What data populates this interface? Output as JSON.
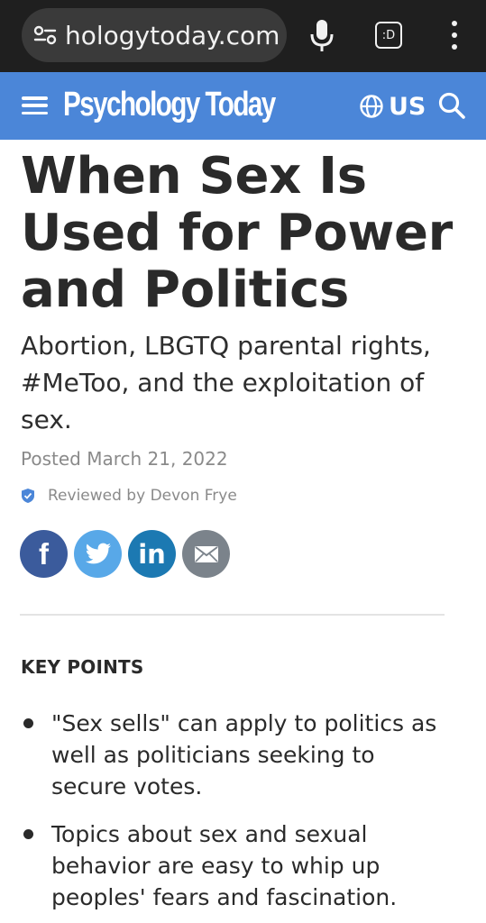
{
  "browser": {
    "url": "hologytoday.com",
    "tab_count": ":D",
    "icons": [
      "site-info-icon",
      "microphone-icon",
      "tabs-icon",
      "more-options-icon"
    ]
  },
  "header": {
    "logo": "Psychology Today",
    "region": "US",
    "brand_color": "#4b86d8",
    "icons": [
      "hamburger-menu-icon",
      "globe-icon",
      "search-icon"
    ]
  },
  "article": {
    "title": "When Sex Is Used for Power and Politics",
    "subtitle": "Abortion, LBGTQ parental rights, #MeToo, and the exploitation of sex.",
    "posted": "Posted March 21, 2022",
    "reviewed": "Reviewed by Devon Frye"
  },
  "share": {
    "facebook": "f",
    "linkedin": "in",
    "icons": [
      "facebook-icon",
      "twitter-icon",
      "linkedin-icon",
      "email-icon"
    ],
    "colors": {
      "facebook": "#3b5b9c",
      "twitter": "#58a8e8",
      "linkedin": "#1c79b2",
      "email": "#7b838b"
    }
  },
  "key_points": {
    "heading": "KEY POINTS",
    "items": [
      "\"Sex sells\" can apply to politics as well as politicians seeking to secure votes.",
      "Topics about sex and sexual behavior are easy to whip up peoples' fears and fascination."
    ]
  }
}
